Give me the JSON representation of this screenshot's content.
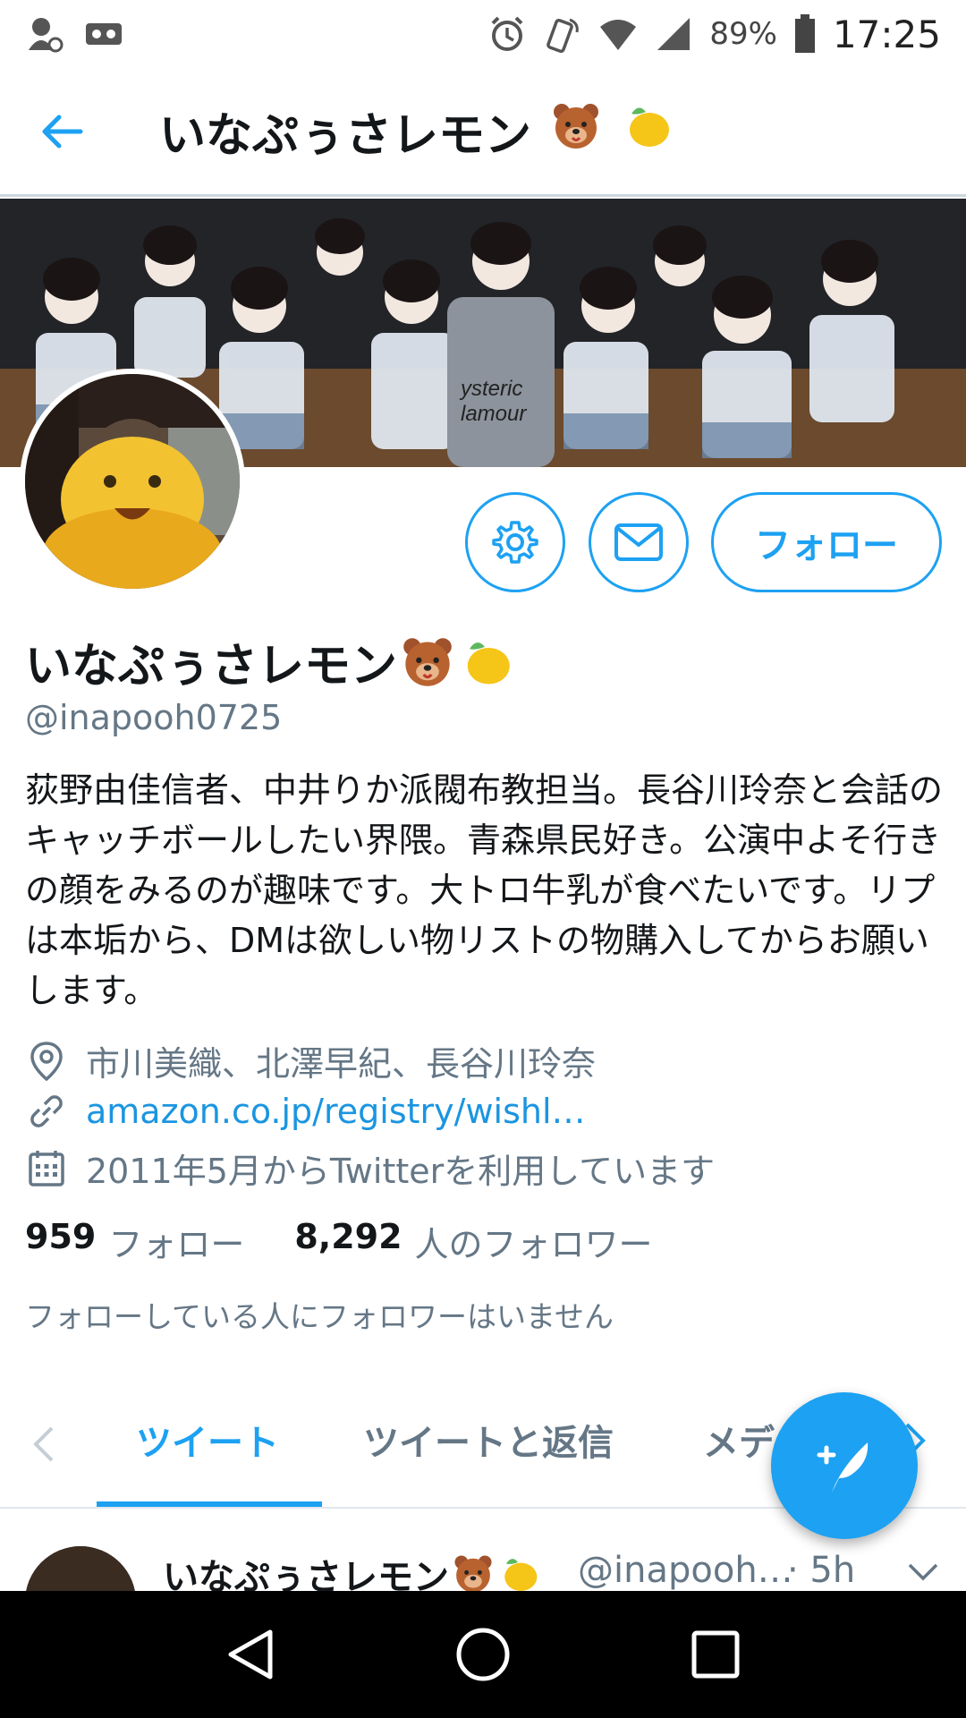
{
  "status_bar": {
    "battery_percent": "89%",
    "time": "17:25",
    "icons": [
      "notification-person-icon",
      "voicemail-icon",
      "alarm-icon",
      "vibrate-icon",
      "wifi-icon",
      "cell-signal-icon",
      "battery-icon"
    ]
  },
  "appbar": {
    "title": "いなぷぅさレモン",
    "back_icon": "arrow-left-icon"
  },
  "profile": {
    "name": "いなぷぅさレモン",
    "handle": "@inapooh0725",
    "bio": "荻野由佳信者、中井りか派閥布教担当。長谷川玲奈と会話のキャッチボールしたい界隈。青森県民好き。公演中よそ行きの顔をみるのが趣味です。大トロ牛乳が食べたいです。リプは本垢から、DMは欲しい物リストの物購入してからお願いします。",
    "location": "市川美織、北澤早紀、長谷川玲奈",
    "link": "amazon.co.jp/registry/wishl…",
    "joined": "2011年5月からTwitterを利用しています",
    "following_count": "959",
    "following_label": "フォロー",
    "followers_count": "8,292",
    "followers_label": "人のフォロワー",
    "mutual_note": "フォローしている人にフォロワーはいません"
  },
  "actions": {
    "follow_label": "フォロー"
  },
  "tabs": [
    {
      "label": "ツイート",
      "active": true
    },
    {
      "label": "ツイートと返信",
      "active": false
    },
    {
      "label": "メディア",
      "active": false
    }
  ],
  "tweet": {
    "name": "いなぷぅさレモン",
    "handle": "@inapooh…",
    "time": "· 5h"
  },
  "colors": {
    "accent": "#1da1f2",
    "secondary_text": "#657786",
    "link": "#1b95e0"
  }
}
